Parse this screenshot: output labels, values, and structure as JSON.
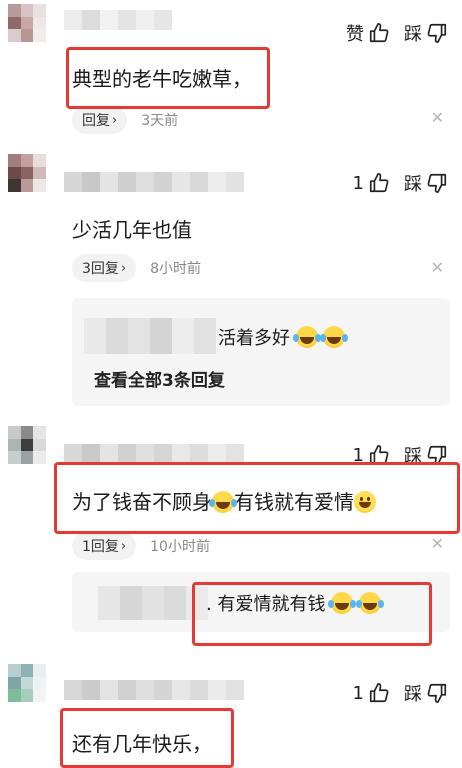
{
  "labels": {
    "like": "赞",
    "dislike": "踩"
  },
  "comments": [
    {
      "text": "典型的老牛吃嫩草，",
      "like_label": "赞",
      "reply_label": "回复",
      "time": "3天前"
    },
    {
      "text": "少活几年也值",
      "like_count": "1",
      "reply_label": "3回复",
      "time": "8小时前",
      "sub_reply": {
        "text": "活着多好",
        "view_all": "查看全部3条回复"
      }
    },
    {
      "text_a": "为了钱奋不顾身",
      "text_b": "有钱就有爱情",
      "like_count": "1",
      "reply_label": "1回复",
      "time": "10小时前",
      "sub_reply": {
        "text": ". 有爱情就有钱"
      }
    },
    {
      "text": "还有几年快乐，",
      "like_count": "1"
    }
  ],
  "colors": {
    "highlight_box": "#e53935",
    "meta_text": "#888888",
    "reply_pill": "#f2f2f2",
    "sub_box": "#f5f5f5"
  },
  "icons": {
    "like": "thumbs-up-icon",
    "dislike": "thumbs-down-icon",
    "close": "close-icon",
    "emoji_laugh": "laughing-tears-emoji",
    "emoji_smile": "grinning-emoji"
  }
}
